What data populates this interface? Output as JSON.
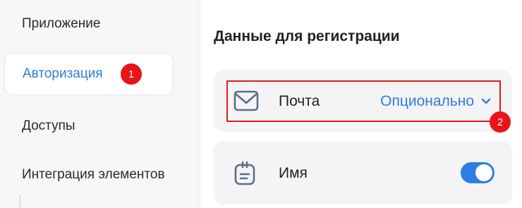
{
  "sidebar": {
    "items": [
      {
        "label": "Приложение"
      },
      {
        "label": "Авторизация"
      },
      {
        "label": "Доступы"
      },
      {
        "label": "Интеграция элементов"
      }
    ]
  },
  "badges": {
    "first": "1",
    "second": "2"
  },
  "main": {
    "title": "Данные для регистрации",
    "email_row": {
      "label": "Почта",
      "value": "Опционально",
      "icon": "mail-icon"
    },
    "name_row": {
      "label": "Имя",
      "icon": "name-tag-icon",
      "toggle_on": true
    }
  },
  "colors": {
    "accent": "#2d7ee0",
    "annotation": "#e31a1a"
  }
}
